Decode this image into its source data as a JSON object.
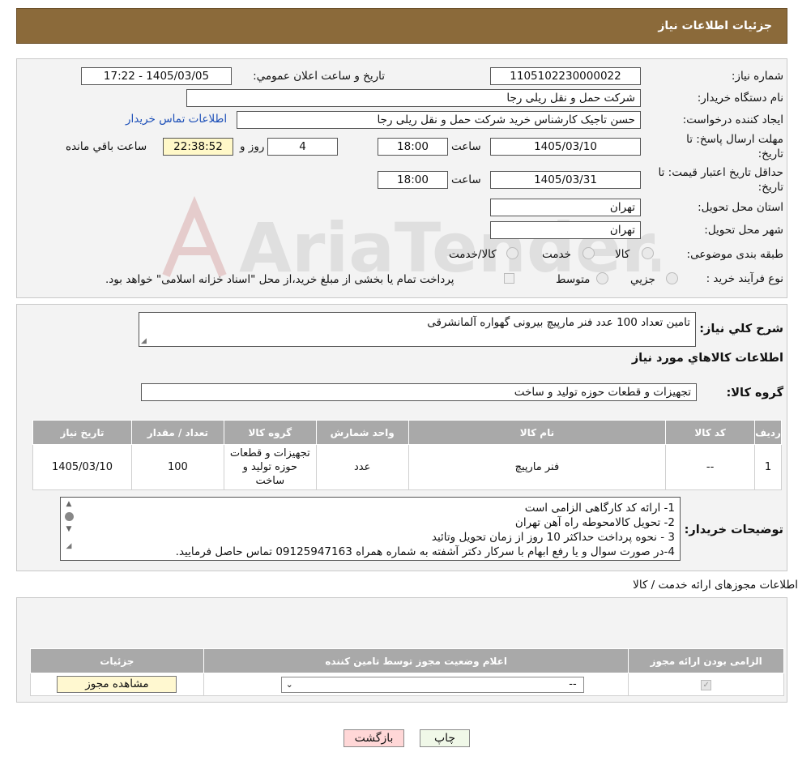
{
  "header": {
    "title": "جزئیات اطلاعات نیاز"
  },
  "watermark": {
    "text": "AriaTender.neT"
  },
  "form": {
    "need_number_label": "شماره نیاز:",
    "need_number": "1105102230000022",
    "announce_label": "تاریخ و ساعت اعلان عمومي:",
    "announce_value": "1405/03/05 - 17:22",
    "buyer_org_label": "نام دستگاه خريدار:",
    "buyer_org": "شرکت حمل و نقل ریلی رجا",
    "creator_label": "ايجاد کننده درخواست:",
    "creator": "حسن تاجیک کارشناس خرید شرکت حمل و نقل ریلی رجا",
    "contact_link": "اطلاعات تماس خريدار",
    "reply_deadline_label_1": "مهلت ارسال پاسخ: تا",
    "reply_deadline_label_2": "تاریخ:",
    "reply_date": "1405/03/10",
    "time_label": "ساعت",
    "reply_time": "18:00",
    "days_value": "4",
    "days_label": "روز و",
    "remaining_time": "22:38:52",
    "remaining_label": "ساعت باقي مانده",
    "price_validity_label_1": "حداقل تاريخ اعتبار قيمت: تا",
    "price_validity_label_2": "تاریخ:",
    "validity_date": "1405/03/31",
    "validity_time": "18:00",
    "province_label": "استان محل تحويل:",
    "province": "تهران",
    "city_label": "شهر محل تحويل:",
    "city": "تهران",
    "category_label": "طبقه بندی موضوعی:",
    "category_options": [
      "کالا",
      "خدمت",
      "کالا/خدمت"
    ],
    "process_label": "نوع فرآیند خرید :",
    "process_options": [
      "جزيي",
      "متوسط"
    ],
    "payment_note": "پرداخت تمام يا بخشی از مبلغ خريد،از محل \"اسناد خزانه اسلامی\" خواهد بود."
  },
  "details": {
    "summary_label": "شرح کلي نياز:",
    "summary": "تامین تعداد 100 عدد فنر مارپیچ بیرونی گهواره آلمانشرقی",
    "goods_info_title": "اطلاعات کالاهاي مورد نياز",
    "goods_group_label": "گروه کالا:",
    "goods_group": "تجهیزات و قطعات حوزه تولید و ساخت",
    "table": {
      "headers": [
        "رديف",
        "کد کالا",
        "نام کالا",
        "واحد شمارش",
        "گروه کالا",
        "تعداد / مقدار",
        "تاريخ نياز"
      ],
      "rows": [
        [
          "1",
          "--",
          "فنر مارپیچ",
          "عدد",
          "تجهیزات و قطعات حوزه تولید و ساخت",
          "100",
          "1405/03/10"
        ]
      ]
    },
    "buyer_notes_label": "توضيحات خريدار:",
    "buyer_notes": [
      "1- ارائه کد کارگاهی الزامی است",
      "2- تحویل کالامحوطه راه آهن تهران",
      "3 - نحوه پرداخت حداکثر 10 روز از زمان تحویل وتائید",
      "4-در صورت سوال و یا رفع ابهام با سرکار دکتر آشفته به شماره همراه 09125947163 تماس حاصل فرمایید."
    ]
  },
  "permits": {
    "title": "اطلاعات مجوزهای ارائه خدمت / کالا",
    "headers": [
      "الزامی بودن ارائه مجوز",
      "اعلام وضعیت مجوز توسط تامین کننده",
      "جزئیات"
    ],
    "select_value": "--",
    "view_button": "مشاهده مجوز"
  },
  "buttons": {
    "print": "چاپ",
    "back": "بازگشت"
  }
}
